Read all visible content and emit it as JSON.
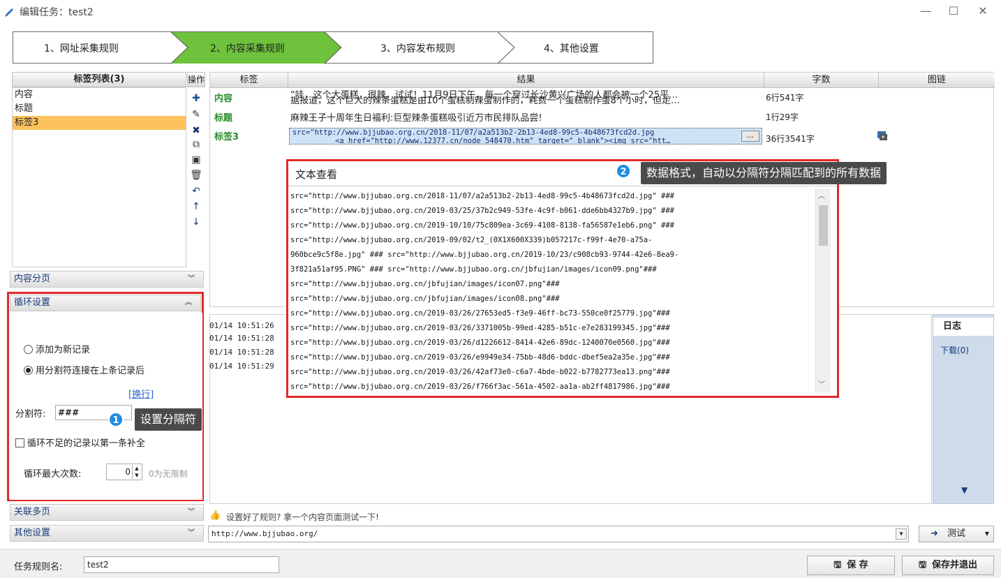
{
  "window": {
    "title": "编辑任务：test2",
    "minimize": "—",
    "maximize": "☐",
    "close": "✕"
  },
  "steps": [
    {
      "label": "1、网址采集规则"
    },
    {
      "label": "2、内容采集规则"
    },
    {
      "label": "3、内容发布规则"
    },
    {
      "label": "4、其他设置"
    }
  ],
  "colors": {
    "active_step": "#6fc23b",
    "highlight_box": "#e02828",
    "badge": "#1f8de0",
    "selected_row": "#fdc25e"
  },
  "tag_list": {
    "header": "标签列表(3)",
    "items": [
      "内容",
      "标题",
      "标签3"
    ],
    "selected_index": 2
  },
  "ops": {
    "header": "操作"
  },
  "accordion": {
    "content_paging": "内容分页",
    "loop_settings": "循环设置",
    "related_pages": "关联多页",
    "other_settings": "其他设置"
  },
  "loop": {
    "opt_new_record": "添加为新记录",
    "opt_join": "用分割符连接在上条记录后",
    "newline_link": "[换行]",
    "separator_label": "分割符:",
    "separator_value": "###",
    "fill_label": "循环不足的记录以第一条补全",
    "max_label": "循环最大次数:",
    "max_value": "0",
    "unlimited_hint": "0为无限制"
  },
  "tooltip1": {
    "num": "1",
    "text": "设置分隔符"
  },
  "tooltip2": {
    "num": "2",
    "text": "数据格式，自动以分隔符分隔匹配到的所有数据"
  },
  "result_table": {
    "headers": [
      "标签",
      "结果",
      "字数",
      "图链"
    ],
    "rows": [
      {
        "tag": "内容",
        "result": "“哇，这个大蛋糕，很辣，试试！11月9日下午，每一个穿过长沙黄兴广场的人都会被一个25平…",
        "result2": "据报道，这个巨大的辣条蛋糕是由10个蛋糕制辣蛋制作的，耗费一个蛋糕制作蛋8个小时，但走…",
        "count": "6行541字"
      },
      {
        "tag": "标题",
        "result": "麻辣王子十周年生日福利:巨型辣条蛋糕吸引近万市民排队品尝!",
        "result2": "",
        "count": "1行29字"
      },
      {
        "tag": "标签3",
        "result": "src=\"http://www.bjjubao.org.cn/2018-11/07/a2a513b2-2b13-4ed8-99c5-4b48673fcd2d.jpg",
        "result2": "<a href=\"http://www.12377.cn/node_548470.htm\" target=\"_blank\"><img src=\"htt…",
        "count": "36行3541字"
      }
    ],
    "ellipsis_button": "..."
  },
  "popup": {
    "title": "文本查看",
    "lines": [
      " src=\"http://www.bjjubao.org.cn/2018-11/07/a2a513b2-2b13-4ed8-99c5-4b48673fcd2d.jpg\" ###",
      "src=\"http://www.bjjubao.org.cn/2019-03/25/37b2c949-53fe-4c9f-b061-dde6bb4327b9.jpg\" ###",
      "src=\"http://www.bjjubao.org.cn/2019-10/10/75c809ea-3c69-4108-8138-fa56587e1eb6.png\" ###",
      "src=\"http://www.bjjubao.org.cn/2019-09/02/t2_(0X1X600X339)b057217c-f99f-4e70-a75a-",
      "960bce9c5f8e.jpg\" ### src=\"http://www.bjjubao.org.cn/2019-10/23/c908cb93-9744-42e6-8ea9-",
      "3f821a51af95.PNG\" ### src=\"http://www.bjjubao.org.cn/jbfujian/images/icon09.png\"###",
      "src=\"http://www.bjjubao.org.cn/jbfujian/images/icon07.png\"###",
      "src=\"http://www.bjjubao.org.cn/jbfujian/images/icon08.png\"###",
      "src=\"http://www.bjjubao.org.cn/2019-03/26/27653ed5-f3e9-46ff-bc73-550ce0f25779.jpg\"###",
      "src=\"http://www.bjjubao.org.cn/2019-03/26/3371005b-99ed-4285-b51c-e7e283199345.jpg\"###",
      "src=\"http://www.bjjubao.org.cn/2019-03/26/d1226612-8414-42e6-89dc-1240070e0560.jpg\"###",
      "src=\"http://www.bjjubao.org.cn/2019-03/26/e9949e34-75bb-48d6-bddc-dbef5ea2a35e.jpg\"###",
      "src=\"http://www.bjjubao.org.cn/2019-03/26/42af73e0-c6a7-4bde-b022-b7782773ea13.png\"###",
      "src=\"http://www.bjjubao.org.cn/2019-03/26/f766f3ac-561a-4502-aa1a-ab2ff4817986.jpg\"###"
    ]
  },
  "log": {
    "times": [
      "01/14 10:51:26",
      "01/14 10:51:28",
      "01/14 10:51:28",
      "01/14 10:51:29"
    ],
    "side_title": "日志",
    "download": "下载(0)"
  },
  "test": {
    "hint": "设置好了规则? 拿一个内容页面测试一下!",
    "url": "http://www.bjjubao.org/",
    "button": "测试"
  },
  "bottom": {
    "rule_name_label": "任务规则名:",
    "rule_name_value": "test2",
    "save": "保 存",
    "save_exit": "保存并退出"
  }
}
